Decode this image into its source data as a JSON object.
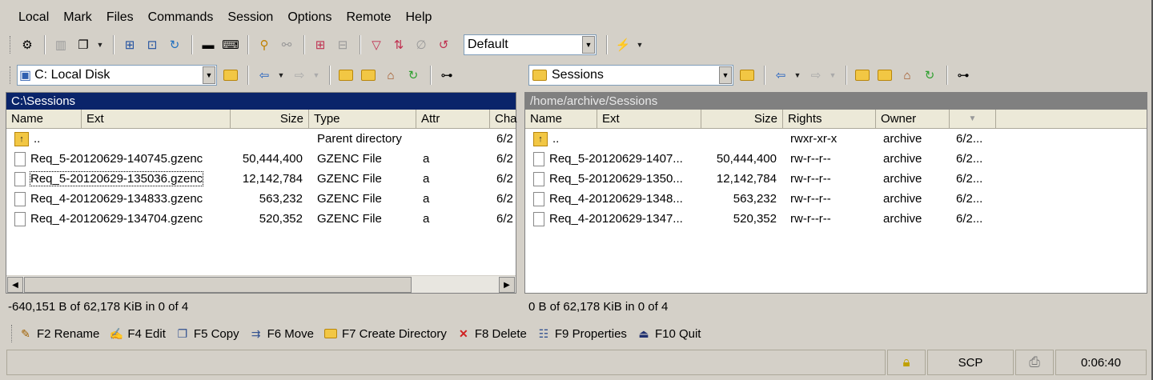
{
  "menu": [
    "Local",
    "Mark",
    "Files",
    "Commands",
    "Session",
    "Options",
    "Remote",
    "Help"
  ],
  "toolbar": {
    "session_combo": "Default"
  },
  "left": {
    "drive_combo": "C: Local Disk",
    "path": "C:\\Sessions",
    "columns": [
      "Name",
      "Ext",
      "Size",
      "Type",
      "Attr",
      "Cha"
    ],
    "rows": [
      {
        "name": "..",
        "size": "",
        "type": "Parent directory",
        "attr": "",
        "changed": "6/2"
      },
      {
        "name": "Req_5-20120629-140745.gzenc",
        "size": "50,444,400",
        "type": "GZENC File",
        "attr": "a",
        "changed": "6/2"
      },
      {
        "name": "Req_5-20120629-135036.gzenc",
        "size": "12,142,784",
        "type": "GZENC File",
        "attr": "a",
        "changed": "6/2"
      },
      {
        "name": "Req_4-20120629-134833.gzenc",
        "size": "563,232",
        "type": "GZENC File",
        "attr": "a",
        "changed": "6/2"
      },
      {
        "name": "Req_4-20120629-134704.gzenc",
        "size": "520,352",
        "type": "GZENC File",
        "attr": "a",
        "changed": "6/2"
      }
    ],
    "status": "-640,151 B of 62,178 KiB in 0 of 4"
  },
  "right": {
    "dir_combo": "Sessions",
    "path": "/home/archive/Sessions",
    "columns": [
      "Name",
      "Ext",
      "Size",
      "Rights",
      "Owner"
    ],
    "rows": [
      {
        "name": "..",
        "size": "",
        "rights": "rwxr-xr-x",
        "owner": "archive",
        "changed": "6/2..."
      },
      {
        "name": "Req_5-20120629-1407...",
        "size": "50,444,400",
        "rights": "rw-r--r--",
        "owner": "archive",
        "changed": "6/2..."
      },
      {
        "name": "Req_5-20120629-1350...",
        "size": "12,142,784",
        "rights": "rw-r--r--",
        "owner": "archive",
        "changed": "6/2..."
      },
      {
        "name": "Req_4-20120629-1348...",
        "size": "563,232",
        "rights": "rw-r--r--",
        "owner": "archive",
        "changed": "6/2..."
      },
      {
        "name": "Req_4-20120629-1347...",
        "size": "520,352",
        "rights": "rw-r--r--",
        "owner": "archive",
        "changed": "6/2..."
      }
    ],
    "status": "0 B of 62,178 KiB in 0 of 4"
  },
  "fkeys": [
    {
      "label": "F2 Rename",
      "icon": "pencil-icon"
    },
    {
      "label": "F4 Edit",
      "icon": "edit-icon"
    },
    {
      "label": "F5 Copy",
      "icon": "copy-icon"
    },
    {
      "label": "F6 Move",
      "icon": "move-icon"
    },
    {
      "label": "F7 Create Directory",
      "icon": "new-folder-icon"
    },
    {
      "label": "F8 Delete",
      "icon": "delete-icon"
    },
    {
      "label": "F9 Properties",
      "icon": "properties-icon"
    },
    {
      "label": "F10 Quit",
      "icon": "quit-icon"
    }
  ],
  "statusbar": {
    "protocol": "SCP",
    "time": "0:06:40"
  },
  "colors": {
    "active_header": "#0a246a",
    "inactive_header": "#808080"
  }
}
